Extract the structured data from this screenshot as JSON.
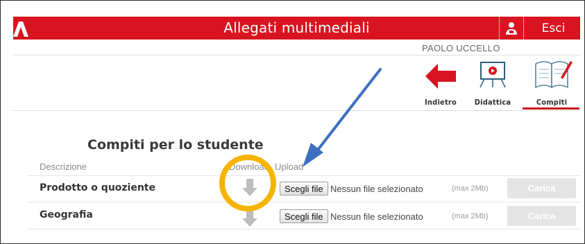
{
  "header": {
    "title": "Allegati multimediali",
    "user_icon": "user-icon",
    "logout_label": "Esci",
    "accent_color": "#d7141f"
  },
  "user": {
    "name": "PAOLO UCCELLO"
  },
  "nav": [
    {
      "label": "Indietro",
      "icon": "back-arrow-icon"
    },
    {
      "label": "Didattica",
      "icon": "whiteboard-icon"
    },
    {
      "label": "Compiti",
      "icon": "notebook-icon",
      "active": true
    }
  ],
  "section": {
    "title": "Compiti per lo studente"
  },
  "table": {
    "headers": {
      "description": "Descrizione",
      "download": "Download",
      "upload": "Upload"
    },
    "rows": [
      {
        "label": "Prodotto o quoziente",
        "choose_label": "Scegli file",
        "no_file": "Nessun file selezionato",
        "max": "(max 2Mb)",
        "upload_label": "Carica"
      },
      {
        "label": "Geografia",
        "choose_label": "Scegli file",
        "no_file": "Nessun file selezionato",
        "max": "(max 2Mb)",
        "upload_label": "Carica"
      }
    ]
  }
}
